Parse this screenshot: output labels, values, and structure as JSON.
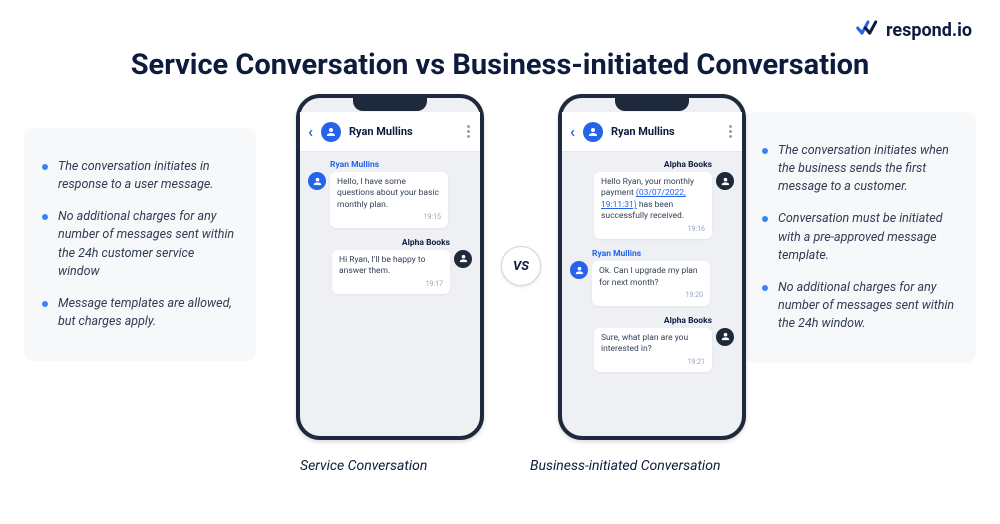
{
  "brand": {
    "name": "respond.io"
  },
  "title": "Service Conversation vs Business-initiated Conversation",
  "vs_label": "VS",
  "captions": {
    "left": "Service Conversation",
    "right": "Business-initiated Conversation"
  },
  "bullets_left": [
    "The conversation initiates in response to a user message.",
    "No additional charges for any number of messages sent within the 24h customer service window",
    "Message templates are allowed, but charges apply."
  ],
  "bullets_right": [
    "The  conversation initiates when the business sends the first message to a customer.",
    "Conversation must be initiated with a pre-approved message template.",
    "No additional charges for any number of messages sent within the 24h window."
  ],
  "phone_left": {
    "contact": "Ryan Mullins",
    "messages": [
      {
        "side": "user",
        "sender": "Ryan Mullins",
        "text": "Hello, I have some questions about your basic monthly plan.",
        "time": "19:15"
      },
      {
        "side": "biz",
        "sender": "Alpha Books",
        "text": "Hi Ryan, I'll be happy to answer them.",
        "time": "19:17"
      }
    ]
  },
  "phone_right": {
    "contact": "Ryan Mullins",
    "messages": [
      {
        "side": "biz",
        "sender": "Alpha Books",
        "text_pre": "Hello Ryan, your monthly payment ",
        "link": "(03/07/2022, 19:11:31)",
        "text_post": " has been successfully received.",
        "time": "19:16"
      },
      {
        "side": "user",
        "sender": "Ryan Mullins",
        "text": "Ok. Can I upgrade my plan for next month?",
        "time": "19:20"
      },
      {
        "side": "biz",
        "sender": "Alpha Books",
        "text": "Sure, what plan are you interested in?",
        "time": "19:21"
      }
    ]
  }
}
